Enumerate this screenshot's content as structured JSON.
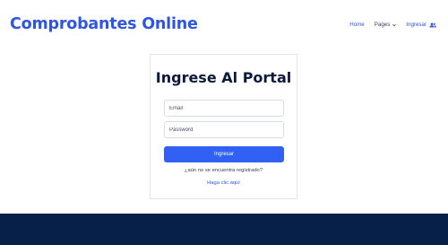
{
  "header": {
    "brand": "Comprobantes Online",
    "nav": {
      "home": "Home",
      "pages": "Pages",
      "login": "Ingresar"
    }
  },
  "login": {
    "title": "Ingrese Al Portal",
    "email_placeholder": "Email",
    "password_placeholder": "Password",
    "submit_label": "Ingresar",
    "question": "¿aún no se encuentra registrado?",
    "register_link": "Haga clic aquí"
  },
  "colors": {
    "brand": "#2f55e4",
    "button": "#3161f2",
    "footer": "#06204a"
  },
  "icons": {
    "pages_dropdown": "chevron-down-icon",
    "login": "users-icon"
  }
}
